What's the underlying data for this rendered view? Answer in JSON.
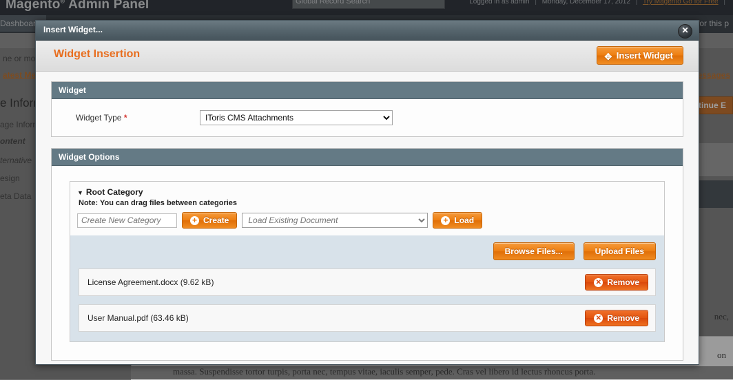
{
  "background": {
    "logo": "Magento",
    "logo_sup": "®",
    "logo_suffix": " Admin Panel",
    "search_placeholder": "Global Record Search",
    "logged_in": "Logged in as admin",
    "date": "Monday, December 17, 2012",
    "try_link": "Try Magento Go for Free",
    "sep": "|",
    "nav": [
      {
        "label": "Dashboard"
      },
      {
        "label": "for this p"
      }
    ],
    "notice_left": "ne or mor",
    "notice_link_left": "atest Mes",
    "notice_link_right": "nessages",
    "section_titles": [
      "e Inform",
      "age Inform"
    ],
    "tabs": [
      "ontent",
      "ternative",
      "esign",
      "eta Data"
    ],
    "continue_button": "ontinue E",
    "lorem_1": "nec,",
    "lorem_2": "on",
    "lorem_bottom": "massa. Suspendisse tortor turpis, porta nec, tempus vitae, iaculis semper, pede. Cras vel libero id lectus rhoncus porta."
  },
  "modal": {
    "title": "Insert Widget...",
    "close_icon": "✕",
    "heading": "Widget Insertion",
    "insert_button": "Insert Widget",
    "widget_section": {
      "header": "Widget",
      "type_label": "Widget Type",
      "required_mark": "*",
      "type_value": "IToris CMS Attachments",
      "type_options": [
        "IToris CMS Attachments"
      ]
    },
    "options_section": {
      "header": "Widget Options",
      "category_title": "Root Category",
      "triangle": "▼",
      "note": "Note: You can drag files between categories",
      "new_category_placeholder": "Create New Category",
      "new_category_value": "",
      "create_button": "Create",
      "load_document_value": "Load Existing Document",
      "load_document_options": [
        "Load Existing Document"
      ],
      "load_button": "Load",
      "browse_button": "Browse Files...",
      "upload_button": "Upload Files",
      "files": [
        {
          "name": "License Agreement.docx (9.62 kB)",
          "remove": "Remove"
        },
        {
          "name": "User Manual.pdf (63.46 kB)",
          "remove": "Remove"
        }
      ]
    }
  },
  "colors": {
    "accent_orange": "#e86e1f",
    "section_header": "#647a85",
    "drop_area": "#d8e2ea",
    "required": "#d4322d"
  }
}
